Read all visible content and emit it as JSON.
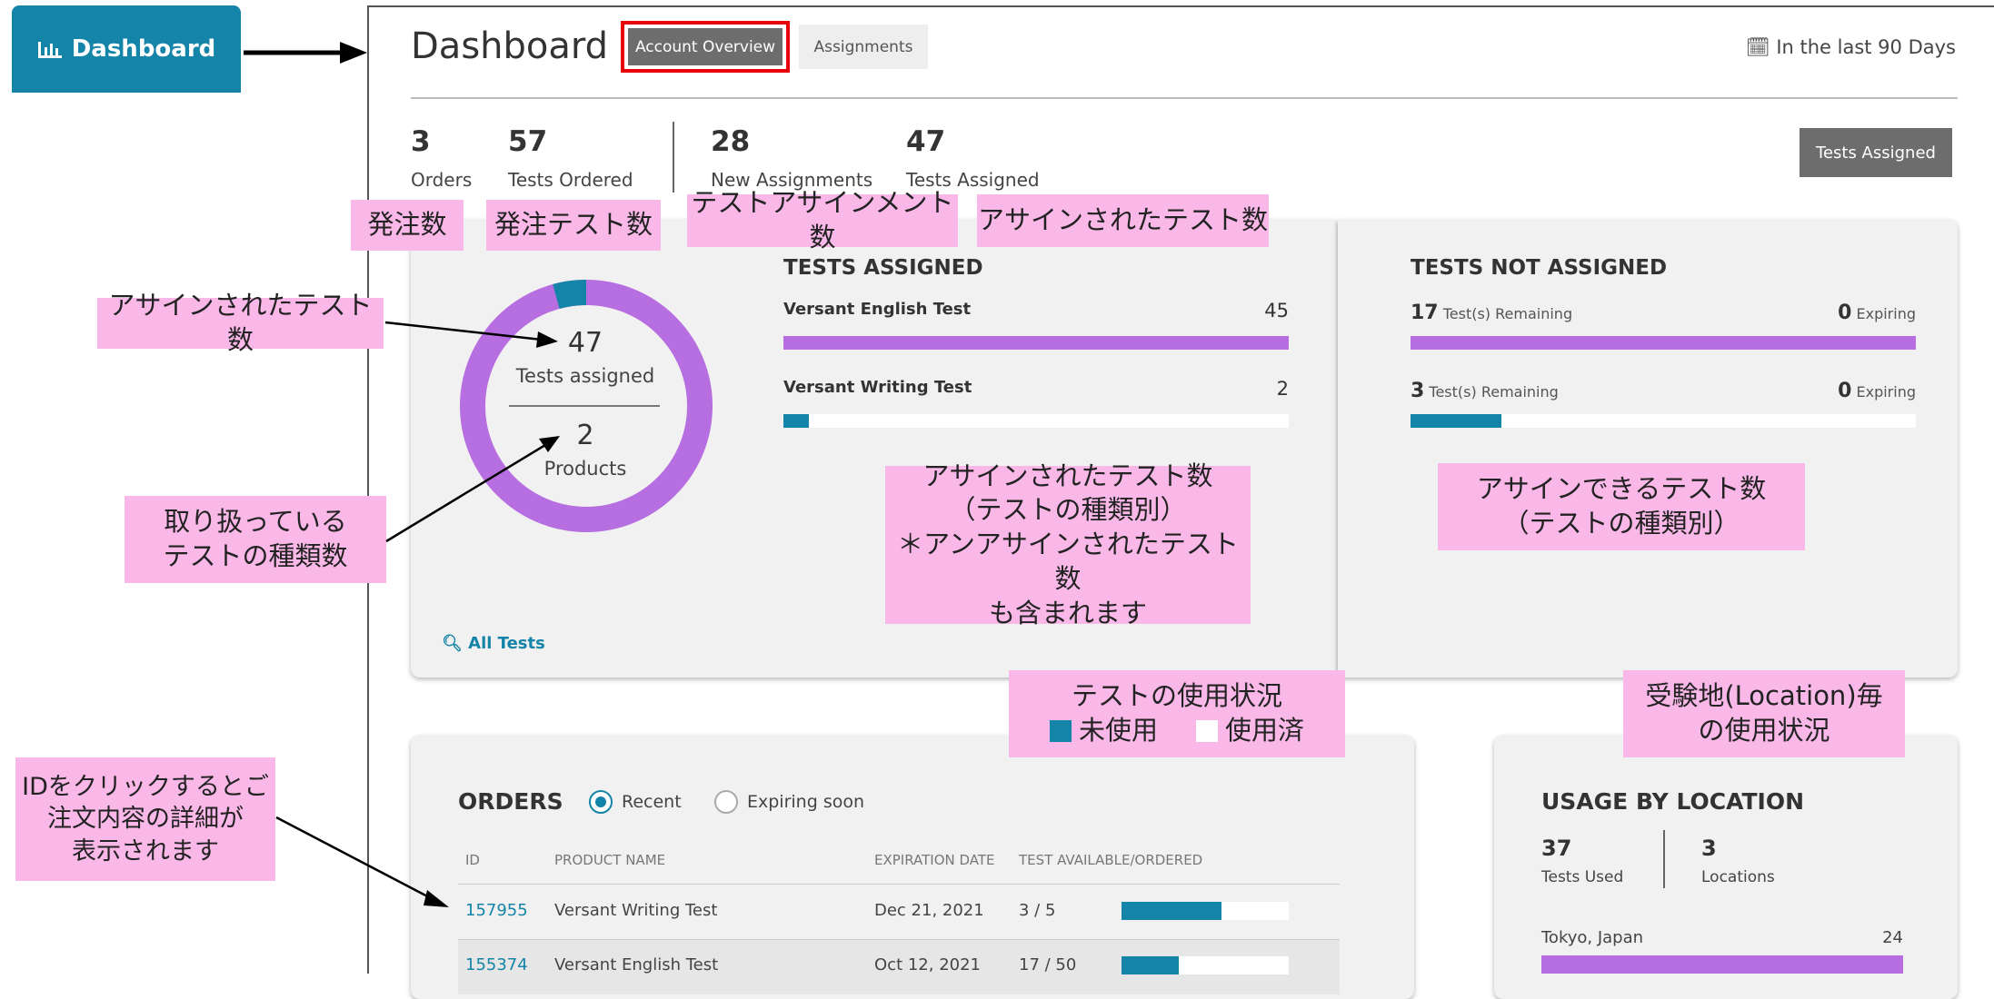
{
  "sidebar": {
    "dashboard_label": "Dashboard",
    "icon": "bar-chart-icon"
  },
  "header": {
    "title": "Dashboard",
    "tabs": [
      "Account Overview",
      "Assignments"
    ],
    "period": "In the last 90 Days",
    "period_icon": "calendar-icon"
  },
  "stats": {
    "orders_value": "3",
    "orders_label": "Orders",
    "tests_ordered_value": "57",
    "tests_ordered_label": "Tests Ordered",
    "new_assignments_value": "28",
    "new_assignments_label": "New Assignments",
    "tests_assigned_value": "47",
    "tests_assigned_label": "Tests Assigned",
    "tests_assigned_button": "Tests Assigned"
  },
  "donut": {
    "center_value": "47",
    "center_label": "Tests assigned",
    "products_value": "2",
    "products_label": "Products",
    "assigned_fraction": 0.957
  },
  "tests_assigned": {
    "heading": "TESTS ASSIGNED",
    "items": [
      {
        "name": "Versant English Test",
        "value": "45",
        "fraction": 1.0,
        "color": "#b66ee0"
      },
      {
        "name": "Versant Writing Test",
        "value": "2",
        "fraction": 0.05,
        "color": "#1484a8"
      }
    ]
  },
  "tests_not_assigned": {
    "heading": "TESTS NOT ASSIGNED",
    "items": [
      {
        "remaining": "17",
        "remaining_label": "Test(s) Remaining",
        "expiring": "0",
        "expiring_label": "Expiring",
        "fraction": 1.0,
        "color": "#b66ee0"
      },
      {
        "remaining": "3",
        "remaining_label": "Test(s) Remaining",
        "expiring": "0",
        "expiring_label": "Expiring",
        "fraction": 0.18,
        "color": "#1484a8"
      }
    ]
  },
  "all_tests_link": "All Tests",
  "orders": {
    "heading": "ORDERS",
    "filter_recent": "Recent",
    "filter_expiring": "Expiring soon",
    "columns": [
      "ID",
      "PRODUCT NAME",
      "EXPIRATION DATE",
      "TEST AVAILABLE/ORDERED"
    ],
    "rows": [
      {
        "id": "157955",
        "product": "Versant Writing Test",
        "expiration": "Dec 21, 2021",
        "available": "3 / 5",
        "fraction": 0.6
      },
      {
        "id": "155374",
        "product": "Versant English Test",
        "expiration": "Oct 12, 2021",
        "available": "17 / 50",
        "fraction": 0.34
      }
    ]
  },
  "usage": {
    "heading": "USAGE BY LOCATION",
    "tests_used_value": "37",
    "tests_used_label": "Tests Used",
    "locations_value": "3",
    "locations_label": "Locations",
    "location_name": "Tokyo, Japan",
    "location_value": "24"
  },
  "annotations": {
    "orders_count": "発注数",
    "tests_ordered_count": "発注テスト数",
    "assignment_count": "テストアサインメント数",
    "assigned_count": "アサインされたテスト数",
    "donut_assigned": "アサインされたテスト数",
    "products_line1": "取り扱っている",
    "products_line2": "テストの種類数",
    "by_type_line1": "アサインされたテスト数",
    "by_type_line2": "（テストの種類別）",
    "by_type_line3": "＊アンアサインされたテスト数",
    "by_type_line4": "も含まれます",
    "assignable_line1": "アサインできるテスト数",
    "assignable_line2": "（テストの種類別）",
    "usage_line1": "テストの使用状況",
    "usage_unused": "未使用",
    "usage_used": "使用済",
    "location_line1": "受験地(Location)毎",
    "location_line2": "の使用状況",
    "id_line1": "IDをクリックするとご",
    "id_line2": "注文内容の詳細が",
    "id_line3": "表示されます"
  },
  "colors": {
    "accent": "#1484a8",
    "purple": "#b66ee0",
    "annotation": "#f9b8e8",
    "highlight": "#e8000b"
  }
}
